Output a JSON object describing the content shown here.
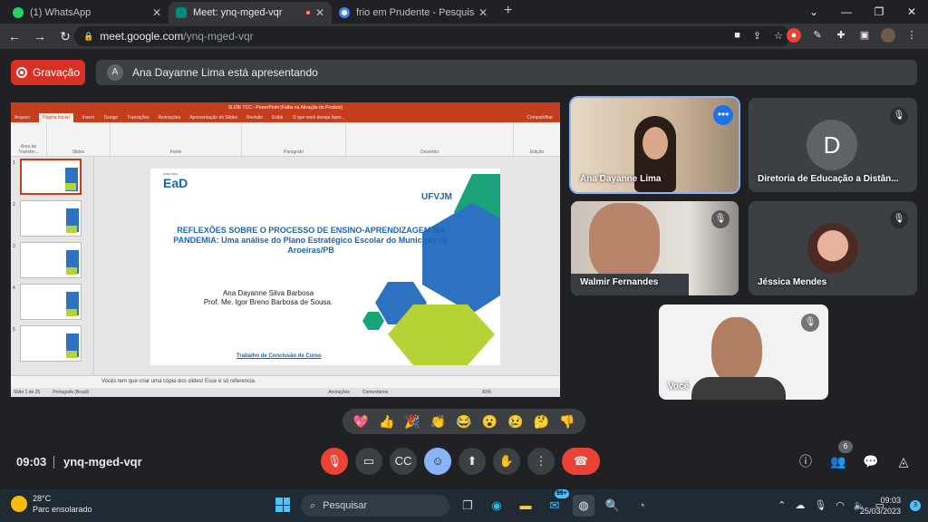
{
  "browser": {
    "tabs": [
      {
        "label": "(1) WhatsApp",
        "color": "#25d366",
        "active": false
      },
      {
        "label": "Meet: ynq-mged-vqr",
        "color": "#00897b",
        "active": true
      },
      {
        "label": "frio em Prudente - Pesquisa Goog",
        "color": "#4285f4",
        "active": false
      }
    ],
    "url_host": "meet.google.com",
    "url_path": "/ynq-mged-vqr"
  },
  "meet": {
    "recording_label": "Gravação",
    "presenter_initial": "A",
    "presenter_text": "Ana Dayanne Lima está apresentando",
    "slide": {
      "window_title": "SLIDE TCC - PowerPoint (Falha na Ativação do Produto)",
      "ribbon_tabs": [
        "Arquivo",
        "Página Inicial",
        "Inserir",
        "Design",
        "Transições",
        "Animações",
        "Apresentação de Slides",
        "Revisão",
        "Exibir",
        "O que você deseja fazer..."
      ],
      "share_label": "Compartilhar",
      "ribbon_groups": [
        "Área de Transfer...",
        "Slides",
        "Fonte",
        "Parágrafo",
        "Desenho",
        "Edição"
      ],
      "logo_ead": "EaD",
      "logo_ead_top": "DIRETORIA",
      "logo_ufvjm": "UFVJM",
      "title": "REFLEXÕES SOBRE O PROCESSO DE ENSINO-APRENDIZAGEM NA PANDEMIA: Uma análise do Plano Estratégico Escolar do Município de Aroeiras/PB",
      "author1": "Ana Dayanne Silva Barbosa",
      "author2": "Prof. Me. Igor Breno Barbosa de Sousa.",
      "footer": "Trabalho de Conclusão de Curso",
      "notes": "Vocês tem que criar uma cópia dos slides! Esse é só referencia.",
      "status_slide": "Slide 1 de 25",
      "status_lang": "Português (Brasil)",
      "status_notes": "Anotações",
      "status_comments": "Comentários",
      "zoom": "83%"
    },
    "participants": [
      {
        "name": "Ana Dayanne Lima",
        "speaking": true
      },
      {
        "name": "Diretoria de Educação a Distân...",
        "initial": "D"
      },
      {
        "name": "Walmir Fernandes"
      },
      {
        "name": "Jéssica Mendes"
      },
      {
        "name": "Você"
      }
    ],
    "reactions": [
      "💖",
      "👍",
      "🎉",
      "👏",
      "😂",
      "😮",
      "😢",
      "🤔",
      "👎"
    ],
    "time": "09:03",
    "meeting_code": "ynq-mged-vqr",
    "participant_count": "6"
  },
  "taskbar": {
    "temperature": "28°C",
    "weather": "Parc ensolarado",
    "search_label": "Pesquisar",
    "mail_badge": "99+",
    "time": "09:03",
    "date": "25/03/2023",
    "notif_count": "3"
  },
  "colors": {
    "accent": "#8ab4f8",
    "danger": "#ea4335",
    "ppt": "#c43e1c"
  }
}
